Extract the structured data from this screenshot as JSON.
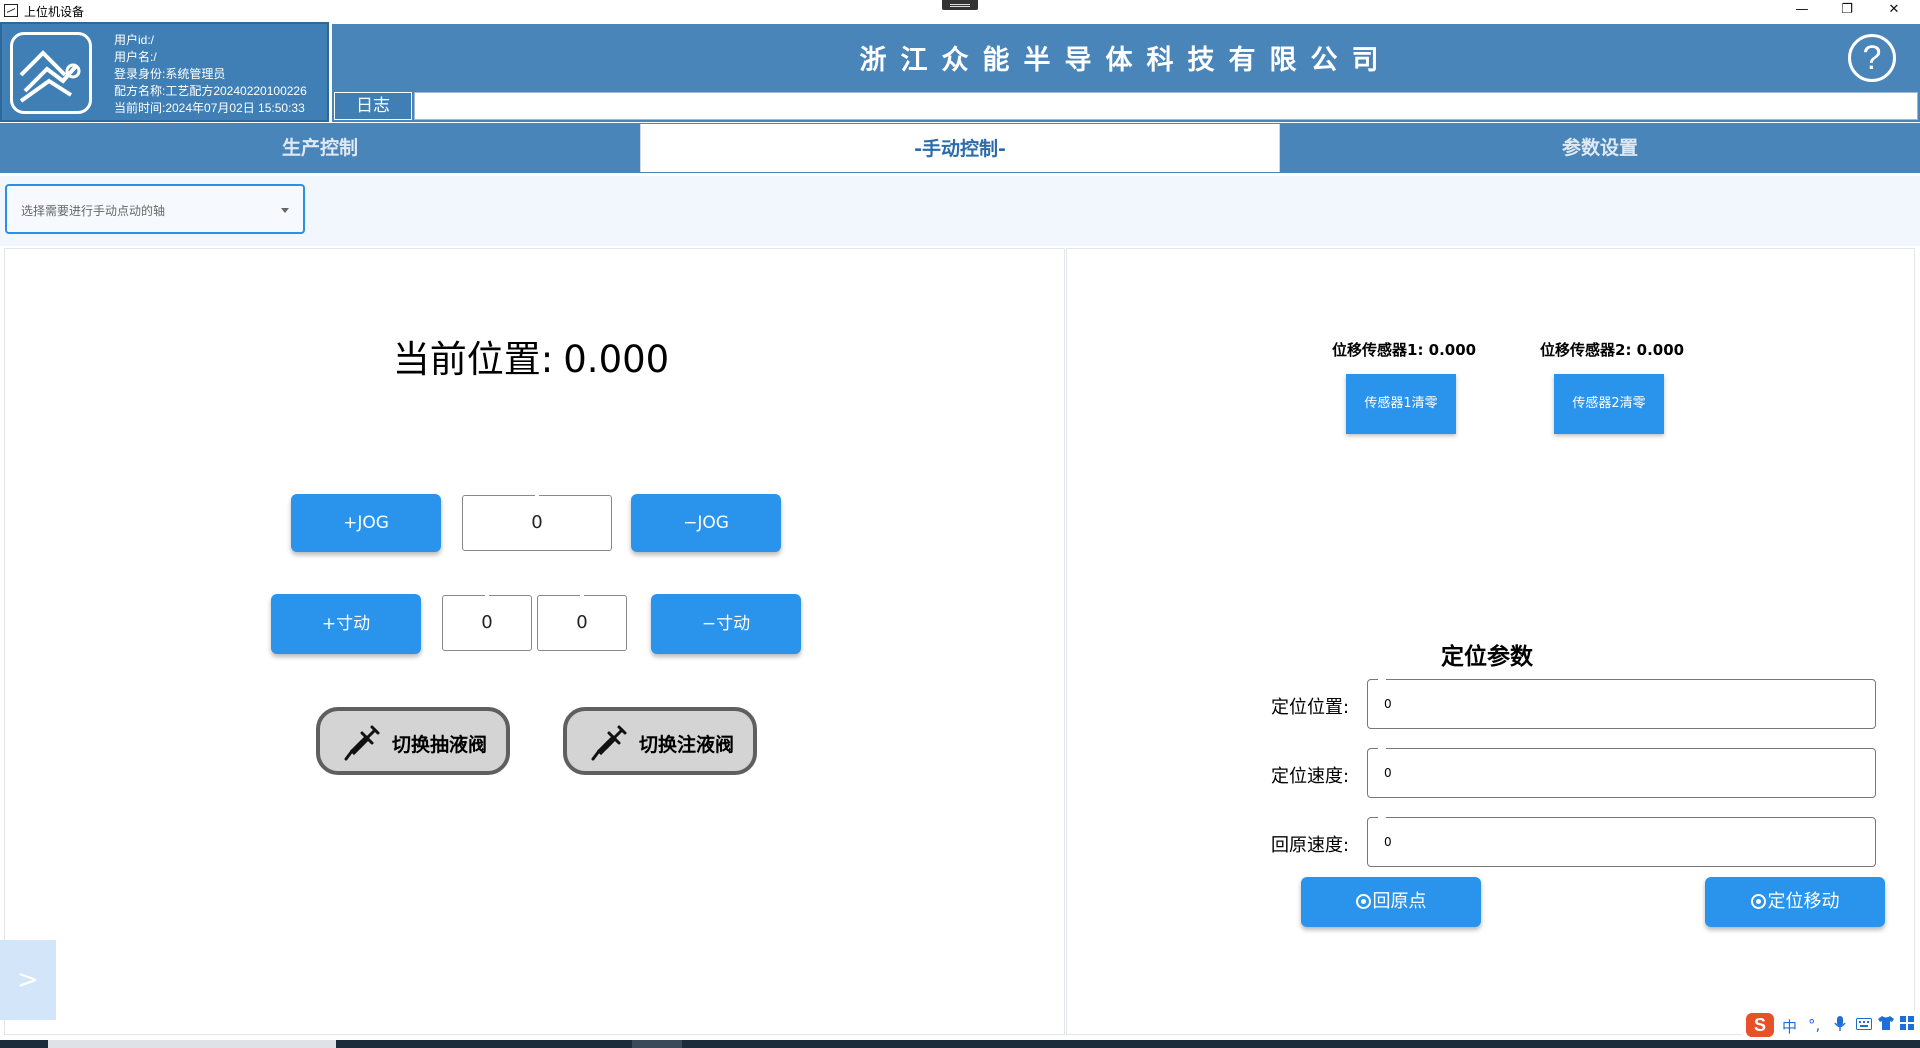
{
  "window": {
    "title": "上位机设备",
    "minimize": "—",
    "restore": "❐",
    "close": "✕"
  },
  "user": {
    "id_line": "用户id:/",
    "name_line": "用户名:/",
    "role_line": "登录身份:系统管理员",
    "recipe_line": "配方名称:工艺配方20240220100226",
    "time_line": "当前时间:2024年07月02日 15:50:33"
  },
  "header": {
    "company": "浙江众能半导体科技有限公司",
    "help": "?",
    "log_label": "日志",
    "log_value": ""
  },
  "tabs": [
    {
      "label": "生产控制"
    },
    {
      "label": "-手动控制-"
    },
    {
      "label": "参数设置"
    }
  ],
  "axis_select": {
    "placeholder": "选择需要进行手动点动的轴"
  },
  "manual": {
    "current_position_label": "当前位置:",
    "current_position_value": "0.000",
    "jog_plus": "+JOG",
    "jog_value": "0",
    "jog_minus": "−JOG",
    "inch_plus": "+寸动",
    "inch_value_1": "0",
    "inch_value_2": "0",
    "inch_minus": "−寸动",
    "valve_draw": "切换抽液阀",
    "valve_inject": "切换注液阀"
  },
  "sensors": {
    "sensor1_label": "位移传感器1: 0.000",
    "sensor2_label": "位移传感器2: 0.000",
    "sensor1_zero": "传感器1清零",
    "sensor2_zero": "传感器2清零"
  },
  "positioning": {
    "title": "定位参数",
    "position_label": "定位位置:",
    "position_value": "0",
    "speed_label": "定位速度:",
    "speed_value": "0",
    "home_speed_label": "回原速度:",
    "home_speed_value": "0",
    "home_button": "回原点",
    "move_button": "定位移动"
  },
  "side_toggle": ">",
  "ime": {
    "logo": "S",
    "lang": "中",
    "punct": "°,"
  },
  "colors": {
    "header_blue": "#4a85ba",
    "button_blue": "#2a94ec",
    "valve_gray": "#d4d4d4"
  }
}
